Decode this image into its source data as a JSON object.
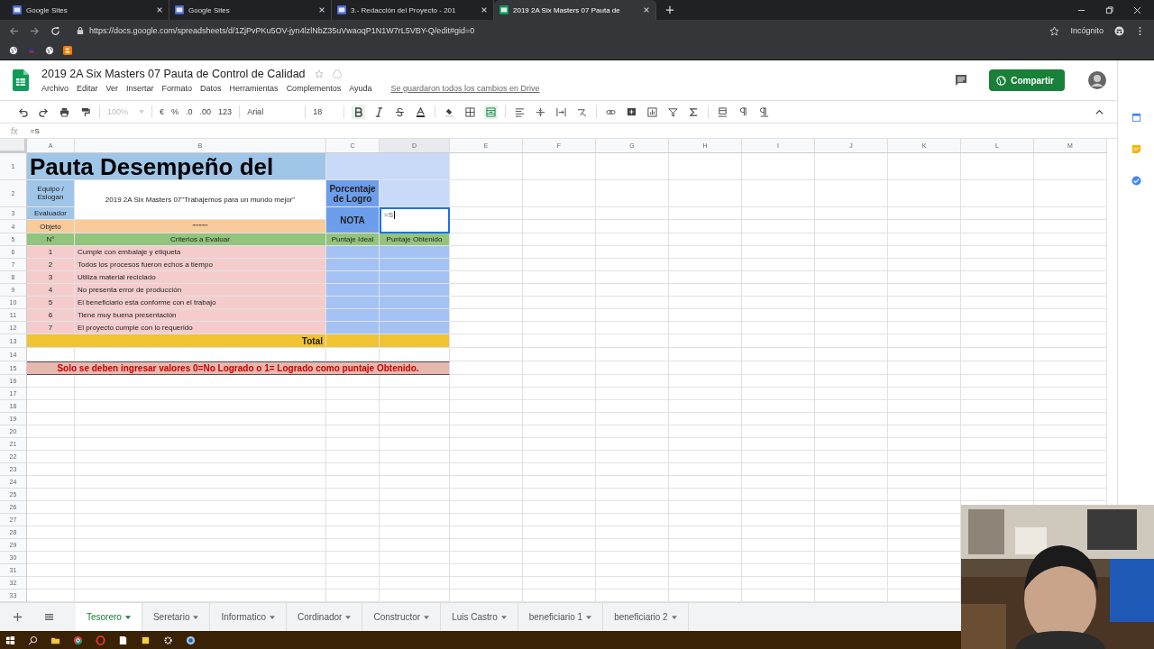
{
  "browser": {
    "tabs": [
      {
        "title": "Google Sites",
        "selected": false
      },
      {
        "title": "Google Sites",
        "selected": false
      },
      {
        "title": "3.- Redacción del Proyecto - 201",
        "selected": false
      },
      {
        "title": "2019 2A Six Masters 07 Pauta de",
        "selected": true
      }
    ],
    "url": "https://docs.google.com/spreadsheets/d/1ZjPvPKu5OV-jyn4lzlNbZ35uVwaoqP1N1W7rL5VBY-Q/edit#gid=0",
    "profile": "Incógnito"
  },
  "doc": {
    "title": "2019 2A Six Masters 07 Pauta de Control de Calidad",
    "menu": [
      "Archivo",
      "Editar",
      "Ver",
      "Insertar",
      "Formato",
      "Datos",
      "Herramientas",
      "Complementos",
      "Ayuda"
    ],
    "save_status": "Se guardaron todos los cambios en Drive",
    "share": "Compartir"
  },
  "toolbar": {
    "zoom": "100%",
    "currency": "€",
    "percent": "%",
    "dec_less": ".0",
    "dec_more": ".00",
    "format": "123",
    "font": "Arial",
    "size": "18",
    "bold": true
  },
  "formula_bar": {
    "label": "fx",
    "value": "=S"
  },
  "columns": [
    "A",
    "B",
    "C",
    "D",
    "E",
    "F",
    "G",
    "H",
    "I",
    "J",
    "K",
    "L",
    "M"
  ],
  "rows": [
    "1",
    "2",
    "3",
    "4",
    "5",
    "6",
    "7",
    "8",
    "9",
    "10",
    "11",
    "12",
    "13",
    "14",
    "15",
    "16",
    "17",
    "18",
    "19",
    "20",
    "21",
    "22",
    "23",
    "24",
    "25",
    "26",
    "27",
    "28",
    "29",
    "30",
    "31",
    "32",
    "33"
  ],
  "sheet": {
    "title": "Pauta Desempeño del",
    "team_label": "Equipo / Eslogan",
    "team_value": "2019 2A Six Masters 07\"Trabajemos para un mundo mejor\"",
    "percent_label": "Porcentaje de Logro",
    "evaluator_label": "Evaluador",
    "grade_label": "NOTA",
    "editing_value": "=S",
    "object_label": "Objeto",
    "object_value": "\"\"\"\"\"\"",
    "headers": [
      "N°",
      "Criterios a Evaluar",
      "Puntaje Ideal",
      "Puntaje Obtenido"
    ],
    "criteria": [
      {
        "n": "1",
        "text": "Cumple con embalaje y etiqueta"
      },
      {
        "n": "2",
        "text": "Todos los procesos fueron echos a tiempo"
      },
      {
        "n": "3",
        "text": "Utiliza material reciclado"
      },
      {
        "n": "4",
        "text": "No presenta error de producción"
      },
      {
        "n": "5",
        "text": "El beneficiario esta conforme con el trabajo"
      },
      {
        "n": "6",
        "text": "Tiene muy buena presentación"
      },
      {
        "n": "7",
        "text": "El proyecto cumple con lo requerido"
      }
    ],
    "total": "Total",
    "note": "Solo se deben ingresar valores 0=No Logrado o 1= Logrado como puntaje Obtenido."
  },
  "sheet_tabs": [
    {
      "label": "Tesorero",
      "selected": true
    },
    {
      "label": "Seretario",
      "selected": false
    },
    {
      "label": "Informatico",
      "selected": false
    },
    {
      "label": "Cordinador",
      "selected": false
    },
    {
      "label": "Constructor",
      "selected": false
    },
    {
      "label": "Luis Castro",
      "selected": false
    },
    {
      "label": "beneficiario 1",
      "selected": false
    },
    {
      "label": "beneficiario 2",
      "selected": false
    }
  ]
}
